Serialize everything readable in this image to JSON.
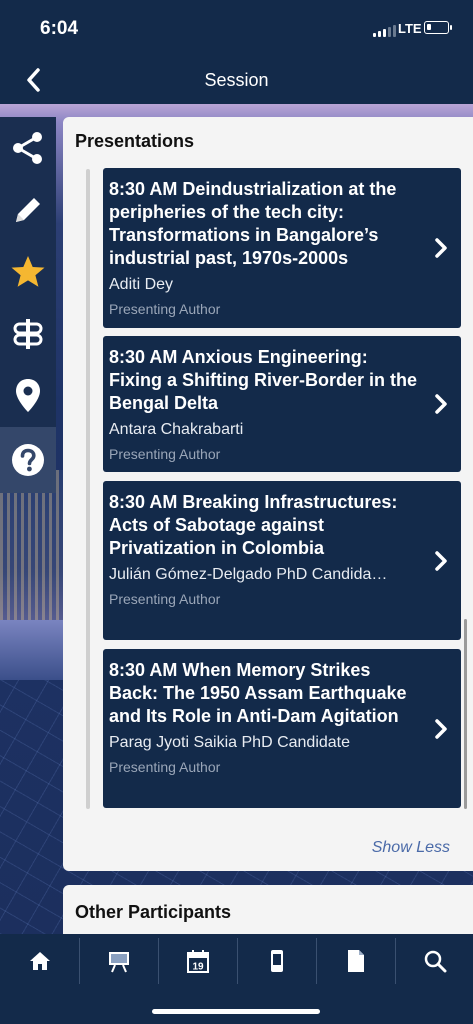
{
  "status_bar": {
    "time": "6:04",
    "network": "LTE"
  },
  "nav": {
    "title": "Session"
  },
  "rail": {
    "items": [
      {
        "name": "share-icon"
      },
      {
        "name": "pencil-icon"
      },
      {
        "name": "star-icon"
      },
      {
        "name": "signpost-icon"
      },
      {
        "name": "location-pin-icon"
      },
      {
        "name": "help-icon"
      }
    ]
  },
  "presentations": {
    "heading": "Presentations",
    "items": [
      {
        "title": "8:30 AM  Deindustrialization at the peripheries of the tech city: Transformations in Bangalore’s industrial past, 1970s-2000s",
        "author": "Aditi Dey",
        "role": "Presenting Author"
      },
      {
        "title": "8:30 AM  Anxious Engineering: Fixing a Shifting River-Border in the Bengal Delta",
        "author": "Antara Chakrabarti",
        "role": "Presenting Author"
      },
      {
        "title": "8:30 AM  Breaking Infrastructures: Acts of Sabotage against Privatization in Colombia",
        "author": "Julián Gómez-Delgado PhD Candida…",
        "role": "Presenting Author"
      },
      {
        "title": "8:30 AM  When Memory Strikes Back: The 1950 Assam Earthquake and Its Role in Anti-Dam Agitation",
        "author": "Parag Jyoti Saikia PhD Candidate",
        "role": "Presenting Author"
      }
    ],
    "show_less": "Show Less"
  },
  "other_participants": {
    "heading": "Other Participants"
  },
  "tabbar": {
    "calendar_day": "19",
    "tabs": [
      {
        "name": "home-icon"
      },
      {
        "name": "presentation-board-icon"
      },
      {
        "name": "calendar-icon"
      },
      {
        "name": "mobile-device-icon"
      },
      {
        "name": "document-icon"
      },
      {
        "name": "search-icon"
      }
    ]
  },
  "colors": {
    "navy": "#132a4a",
    "accent_star": "#f5b731",
    "card_bg": "#f4f4f4",
    "link": "#4a6aa8"
  }
}
